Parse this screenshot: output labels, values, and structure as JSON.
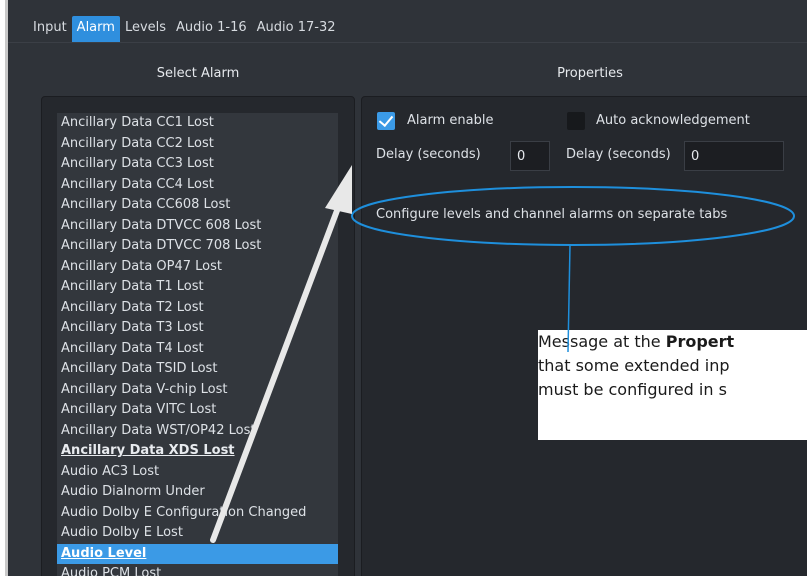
{
  "tabs": [
    {
      "label": "Input",
      "active": false
    },
    {
      "label": "Alarm",
      "active": true
    },
    {
      "label": "Levels",
      "active": false
    },
    {
      "label": "Audio 1-16",
      "active": false
    },
    {
      "label": "Audio 17-32",
      "active": false
    }
  ],
  "select_alarm": {
    "title": "Select Alarm",
    "items": [
      {
        "label": "Ancillary Data CC1 Lost"
      },
      {
        "label": "Ancillary Data CC2 Lost"
      },
      {
        "label": "Ancillary Data CC3 Lost"
      },
      {
        "label": "Ancillary Data CC4 Lost"
      },
      {
        "label": "Ancillary Data CC608 Lost"
      },
      {
        "label": "Ancillary Data DTVCC 608 Lost"
      },
      {
        "label": "Ancillary Data DTVCC 708 Lost"
      },
      {
        "label": "Ancillary Data OP47 Lost"
      },
      {
        "label": "Ancillary Data T1 Lost"
      },
      {
        "label": "Ancillary Data T2 Lost"
      },
      {
        "label": "Ancillary Data T3 Lost"
      },
      {
        "label": "Ancillary Data T4 Lost"
      },
      {
        "label": "Ancillary Data TSID Lost"
      },
      {
        "label": "Ancillary Data V-chip Lost"
      },
      {
        "label": "Ancillary Data VITC Lost"
      },
      {
        "label": "Ancillary Data WST/OP42 Lost"
      },
      {
        "label": "Ancillary Data XDS Lost",
        "style": "bold"
      },
      {
        "label": "Audio AC3 Lost"
      },
      {
        "label": "Audio Dialnorm Under"
      },
      {
        "label": "Audio Dolby E Configuration Changed"
      },
      {
        "label": "Audio Dolby E Lost"
      },
      {
        "label": "Audio Level",
        "style": "selected"
      },
      {
        "label": "Audio PCM Lost"
      }
    ]
  },
  "properties": {
    "title": "Properties",
    "alarm_enable_label": "Alarm enable",
    "alarm_enable_checked": true,
    "auto_ack_label": "Auto acknowledgement",
    "auto_ack_checked": false,
    "delay1_label": "Delay (seconds)",
    "delay1_value": "0",
    "delay2_label": "Delay (seconds)",
    "delay2_value": "0",
    "message": "Configure levels and channel alarms on separate tabs"
  },
  "callout": {
    "line1_prefix": "Message at the ",
    "line1_bold": "Propert",
    "line2": "that some extended inp",
    "line3": "must be configured in s"
  },
  "colors": {
    "accent": "#3b9ae6",
    "annotation": "#1e8fdc",
    "arrow": "#e8e8e8",
    "background": "#2f3339"
  }
}
